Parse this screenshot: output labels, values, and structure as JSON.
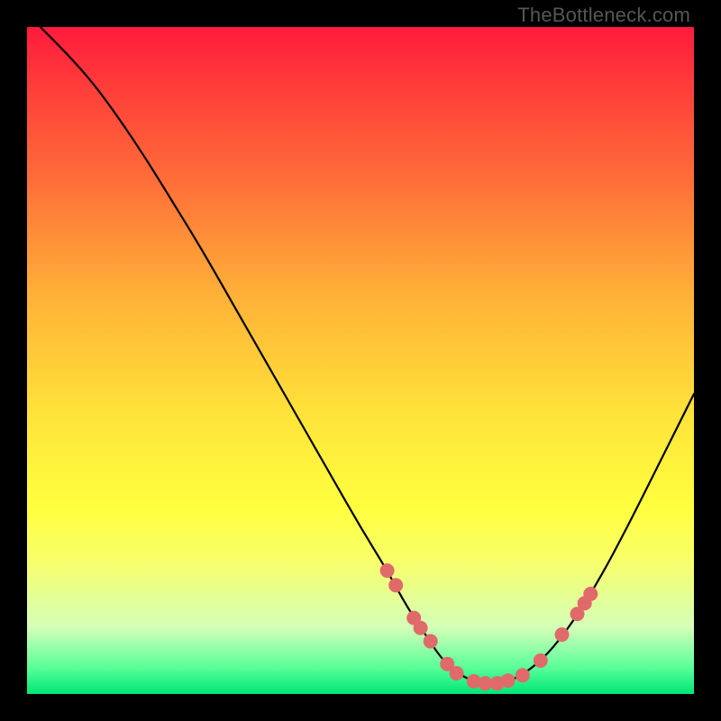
{
  "watermark": "TheBottleneck.com",
  "chart_data": {
    "type": "line",
    "title": "",
    "xlabel": "",
    "ylabel": "",
    "xlim": [
      0,
      100
    ],
    "ylim": [
      0,
      100
    ],
    "curve": {
      "name": "bottleneck-curve",
      "x": [
        2,
        6,
        10,
        14,
        18,
        22,
        26,
        30,
        34,
        38,
        42,
        46,
        50,
        54,
        57,
        60,
        62,
        64,
        66,
        68,
        71,
        74,
        78,
        82,
        86,
        90,
        94,
        98,
        100
      ],
      "y": [
        100,
        96,
        91.5,
        86,
        80,
        73.5,
        67,
        60,
        53,
        46,
        39,
        32,
        25,
        18.5,
        13,
        8.5,
        5.5,
        3.5,
        2.3,
        1.6,
        1.6,
        2.6,
        5.8,
        11,
        17.5,
        25,
        33,
        41,
        45
      ]
    },
    "markers": {
      "name": "highlight-points",
      "color": "#e06a6a",
      "radius": 8,
      "points": [
        {
          "x": 54,
          "y": 18.5
        },
        {
          "x": 55.3,
          "y": 16.3
        },
        {
          "x": 58,
          "y": 11.4
        },
        {
          "x": 59,
          "y": 9.9
        },
        {
          "x": 60.5,
          "y": 7.9
        },
        {
          "x": 63,
          "y": 4.5
        },
        {
          "x": 64.4,
          "y": 3.1
        },
        {
          "x": 67,
          "y": 1.9
        },
        {
          "x": 68.7,
          "y": 1.6
        },
        {
          "x": 70.5,
          "y": 1.6
        },
        {
          "x": 72.1,
          "y": 2.0
        },
        {
          "x": 74.3,
          "y": 2.8
        },
        {
          "x": 77,
          "y": 5.0
        },
        {
          "x": 80.2,
          "y": 8.9
        },
        {
          "x": 82.5,
          "y": 12.0
        },
        {
          "x": 83.6,
          "y": 13.6
        },
        {
          "x": 84.5,
          "y": 15.0
        }
      ]
    }
  }
}
